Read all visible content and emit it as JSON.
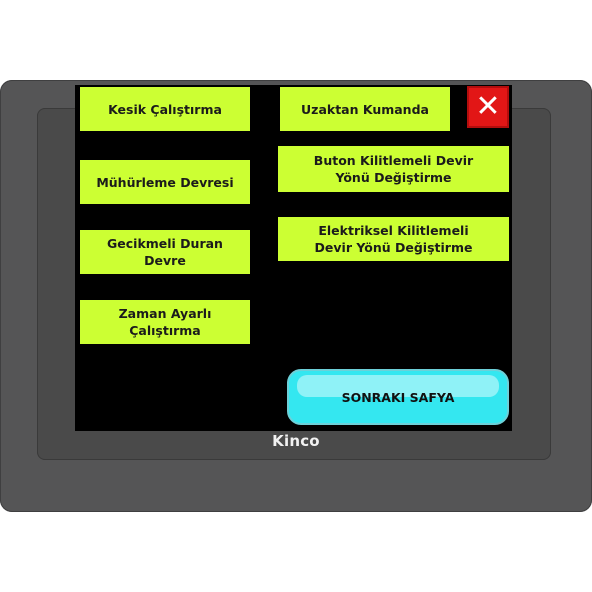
{
  "brand": "Kinco",
  "buttons": {
    "kesik": "Kesik Çalıştırma",
    "muhurleme": "Mühürleme Devresi",
    "gecikmeli": "Gecikmeli Duran\nDevre",
    "zaman": "Zaman Ayarlı\nÇalıştırma",
    "uzaktan": "Uzaktan Kumanda",
    "buton_kilitlemeli": "Buton Kilitlemeli Devir\nYönü Değiştirme",
    "elektriksel": "Elektriksel Kilitlemeli\nDevir Yönü Değiştirme",
    "close": "✕",
    "next": "SONRAKI SAFYA"
  },
  "colors": {
    "tile": "#ccff33",
    "next": "#34e7f0",
    "close": "#e21616",
    "device": "#555556"
  },
  "icons": {
    "close": "close-icon"
  }
}
